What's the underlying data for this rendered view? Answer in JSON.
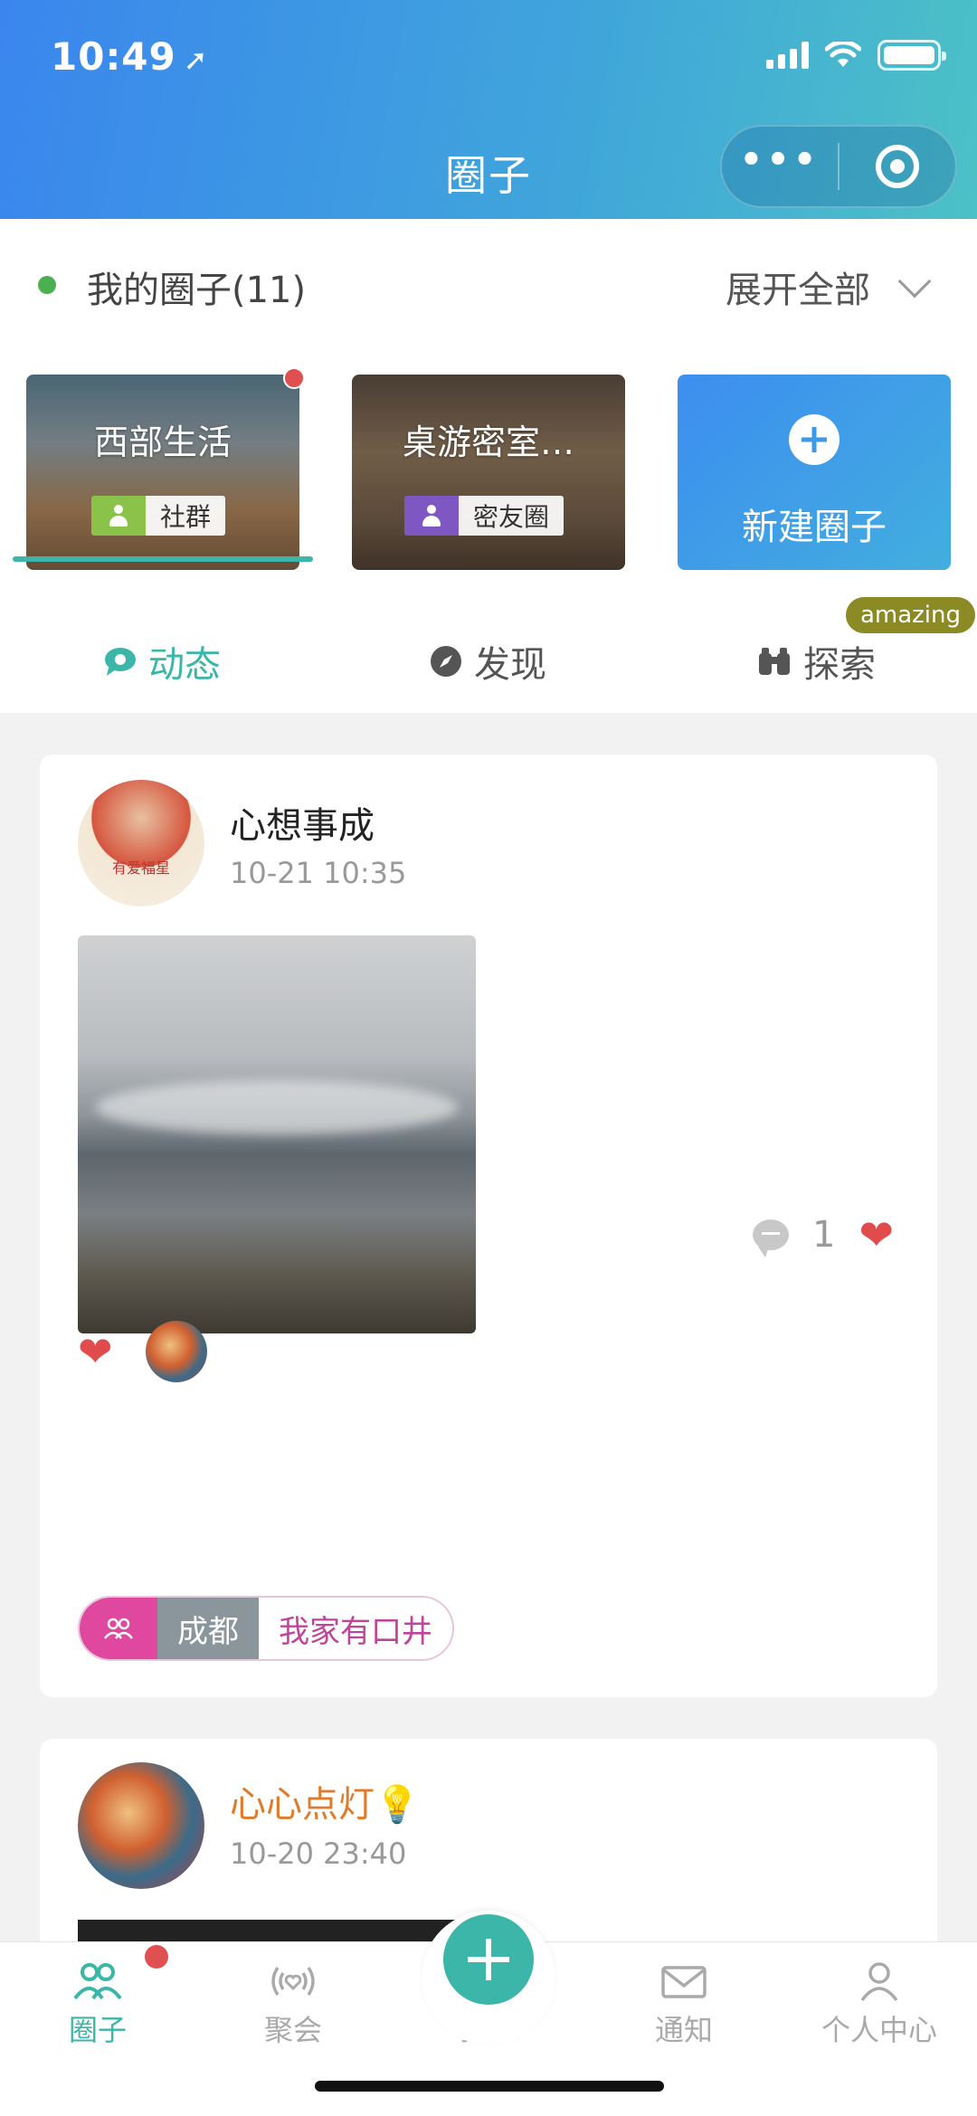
{
  "status_bar": {
    "time": "10:49",
    "location_glyph": "➚"
  },
  "header": {
    "title": "圈子",
    "capsule_more": "•••"
  },
  "my_circles": {
    "title": "我的圈子(11)",
    "expand_label": "展开全部"
  },
  "circle_cards": [
    {
      "title": "西部生活",
      "tag": "社群"
    },
    {
      "title": "桌游密室…",
      "tag": "密友圈"
    }
  ],
  "new_circle": {
    "label": "新建圈子"
  },
  "tabs": [
    {
      "label": "动态",
      "icon": "chat-bubble-icon"
    },
    {
      "label": "发现",
      "icon": "compass-icon"
    },
    {
      "label": "探索",
      "icon": "binoculars-icon"
    }
  ],
  "badge_amazing": "amazing",
  "posts": [
    {
      "user": "心想事成",
      "time": "10-21 10:35",
      "avatar_text": "有爱福星",
      "comment_count": "1",
      "chip_city": "成都",
      "chip_circle": "我家有口井"
    },
    {
      "user": "心心点灯💡",
      "time": "10-20 23:40"
    }
  ],
  "bottom_nav": [
    {
      "label": "圈子",
      "icon": "people-icon"
    },
    {
      "label": "聚会",
      "icon": "broadcast-heart-icon"
    },
    {
      "label": "打卡",
      "icon": "plus-icon"
    },
    {
      "label": "通知",
      "icon": "mail-icon"
    },
    {
      "label": "个人中心",
      "icon": "user-icon"
    }
  ],
  "colors": {
    "accent": "#3bb6a8",
    "header_start": "#3a86ee",
    "header_end": "#4cc1c6",
    "badge": "#e05050"
  }
}
